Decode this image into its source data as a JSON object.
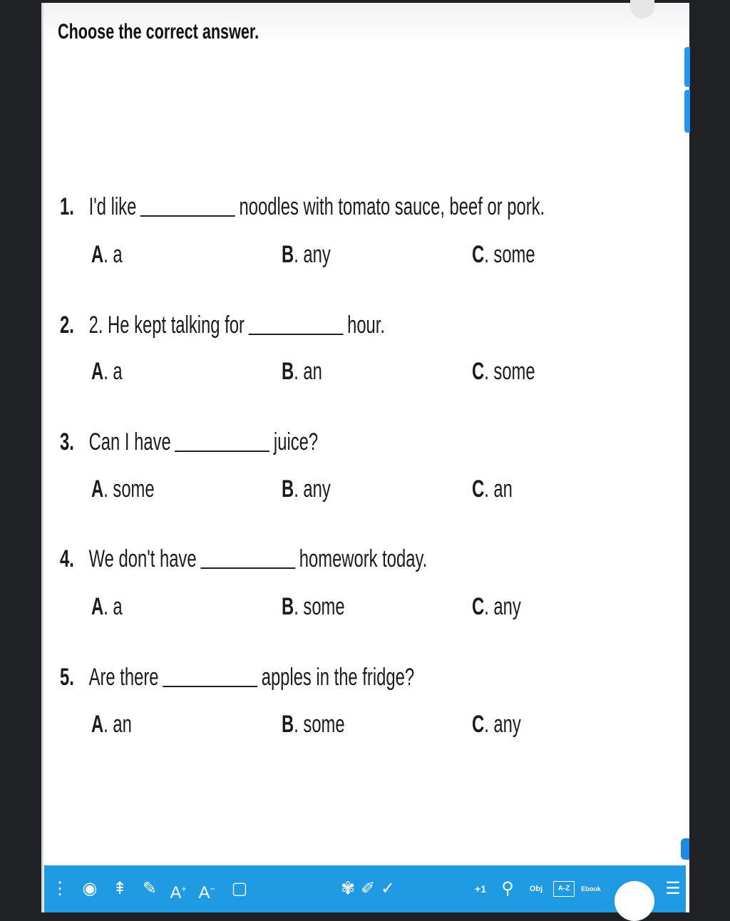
{
  "heading": "Choose the correct answer.",
  "questions": [
    {
      "num": "1.",
      "before": "I'd like",
      "after": "noodles with tomato sauce, beef or pork.",
      "options": [
        {
          "letter": "A",
          "text": ". a"
        },
        {
          "letter": "B",
          "text": ". any"
        },
        {
          "letter": "C",
          "text": ". some"
        }
      ]
    },
    {
      "num": "2.",
      "before": "2. He kept talking for",
      "after": "hour.",
      "options": [
        {
          "letter": "A",
          "text": ". a"
        },
        {
          "letter": "B",
          "text": ". an"
        },
        {
          "letter": "C",
          "text": ". some"
        }
      ]
    },
    {
      "num": "3.",
      "before": "Can I have",
      "after": "juice?",
      "options": [
        {
          "letter": "A",
          "text": ". some"
        },
        {
          "letter": "B",
          "text": ". any"
        },
        {
          "letter": "C",
          "text": ". an"
        }
      ]
    },
    {
      "num": "4.",
      "before": "We don't have",
      "after": "homework today.",
      "options": [
        {
          "letter": "A",
          "text": ". a"
        },
        {
          "letter": "B",
          "text": ". some"
        },
        {
          "letter": "C",
          "text": ". any"
        }
      ]
    },
    {
      "num": "5.",
      "before": "Are there",
      "after": "apples in the fridge?",
      "options": [
        {
          "letter": "A",
          "text": ". an"
        },
        {
          "letter": "B",
          "text": ". some"
        },
        {
          "letter": "C",
          "text": ". any"
        }
      ]
    }
  ],
  "toolbar": {
    "icons": [
      "menu-dots-icon",
      "select-icon",
      "highlighter-icon",
      "pen-icon",
      "font-increase-icon",
      "font-decrease-icon",
      "frame-icon",
      "reveal-icon",
      "pencil-icon",
      "check-icon",
      "plus-one-icon",
      "pin-icon",
      "obj-icon",
      "az-icon",
      "ebook-icon",
      "list-icon"
    ],
    "plus_one": "+1",
    "obj": "Obj",
    "az": "A-Z",
    "ebook": "Ebook"
  },
  "colors": {
    "toolbar": "#1e9be2",
    "background": "#202124",
    "page": "#ffffff"
  }
}
